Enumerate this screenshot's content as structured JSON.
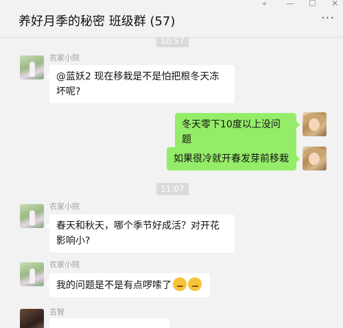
{
  "window": {
    "pin_icon": "pin-icon",
    "minimize": "—",
    "maximize": "☐",
    "close": "✕"
  },
  "header": {
    "title": "养好月季的秘密 班级群 (57)",
    "more": "···"
  },
  "chat": {
    "times": [
      "10:57",
      "11:07"
    ],
    "messages": [
      {
        "sender": "农家小院",
        "text": "@蓝妖2 现在移栽是不是怕把根冬天冻坏呢?"
      },
      {
        "sender": "",
        "text": "冬天零下10度以上没问题"
      },
      {
        "sender": "",
        "text": "如果很冷就开春发芽前移栽"
      },
      {
        "sender": "农家小院",
        "text": "春天和秋天，哪个季节好成活？对开花影响小?"
      },
      {
        "sender": "农家小院",
        "text": "我的问题是不是有点啰嗦了",
        "emoji": [
          "thinking-face-icon",
          "thinking-face-icon"
        ]
      },
      {
        "sender": "吉智",
        "text": ""
      }
    ]
  }
}
